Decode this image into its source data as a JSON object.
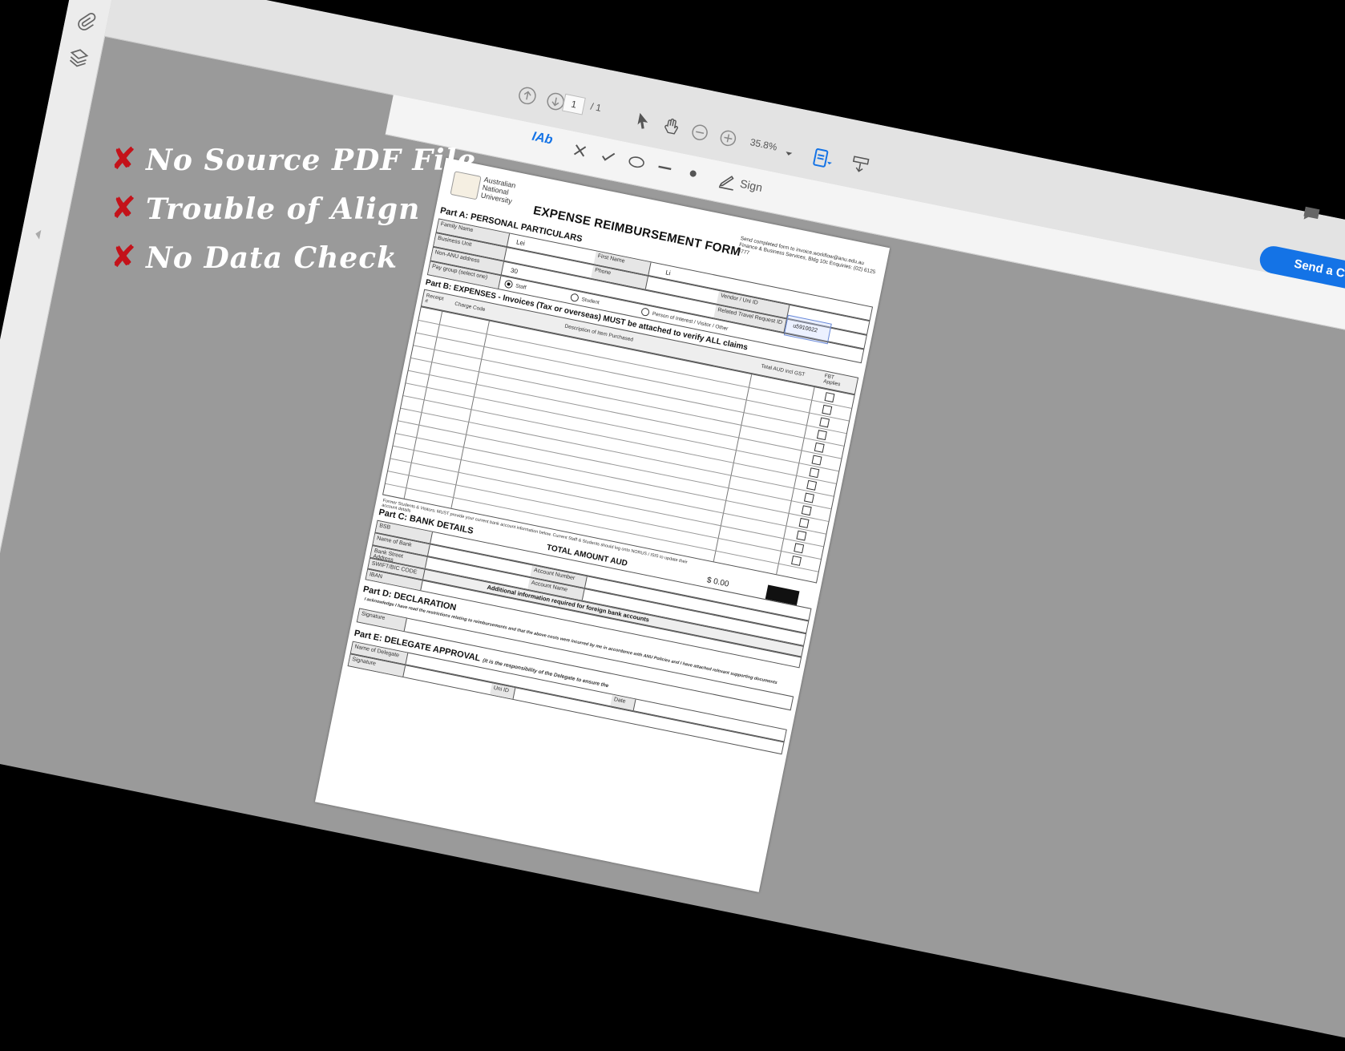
{
  "toolbar": {
    "page_current": "1",
    "page_total": "/ 1",
    "zoom": "35.8%",
    "sign": "Sign",
    "send": "Send a Co"
  },
  "overlay": {
    "items": [
      {
        "mark": "✘",
        "text": "No Source PDF File"
      },
      {
        "mark": "✘",
        "text": "Trouble of Align"
      },
      {
        "mark": "✘",
        "text": "No Data Check"
      }
    ]
  },
  "document": {
    "university": "Australian National University",
    "title": "EXPENSE REIMBURSEMENT FORM",
    "send_note": "Send completed form to invoice.workflow@anu.edu.au Finance & Business Services, Bldg 10c Enquiries: (02) 6125 4777",
    "part_a": "Part A: PERSONAL PARTICULARS",
    "family_name_label": "Family Name",
    "family_name_value": "Lei",
    "first_name_label": "First Name",
    "first_name_value": "Li",
    "business_unit_label": "Business Unit",
    "phone_label": "Phone",
    "vendor_label": "Vendor / Uni ID",
    "non_anu_label": "Non-ANU address",
    "non_anu_value": "30",
    "related_travel_label": "Related Travel Request ID",
    "related_travel_value": "u5910022",
    "pay_group_label": "Pay group (select one)",
    "staff": "Staff",
    "student": "Student",
    "poi": "Person of Interest / Visitor / Other",
    "part_b": "Part B: EXPENSES - Invoices (Tax or overseas) MUST be attached to verify ALL claims",
    "receipt_label": "Receipt #",
    "charge_code_label": "Charge Code",
    "description_label": "Description of Item Purchased",
    "total_incl_label": "Total AUD incl GST",
    "fbt_label": "FBT Applies",
    "former_note": "Former Students & Visitors: MUST provide your current bank account information below. Current Staff & Students should log onto NORUS / ISIS to update their account details",
    "total_amount_label": "TOTAL AMOUNT AUD",
    "total_amount_value": "$ 0.00",
    "part_c": "Part C: BANK DETAILS",
    "bsb_label": "BSB",
    "bank_name_label": "Name of Bank",
    "account_number_label": "Account Number",
    "bank_street_label": "Bank Street Address",
    "account_name_label": "Account Name",
    "swift_label": "SWIFT/BIC CODE",
    "iban_label": "IBAN",
    "foreign_note": "Additional information required for foreign bank accounts",
    "part_d": "Part D: DECLARATION",
    "declaration": "I acknowledge I have read the restrictions relating to reimbursements and that the above costs were incurred by me in accordance with ANU Policies and I have attached relevant supporting documents",
    "signature_label": "Signature",
    "part_e": "Part E: DELEGATE APPROVAL",
    "delegate_note": "(It is the responsibility of the Delegate to ensure the",
    "delegate_name_label": "Name of Delegate",
    "uni_id_label": "Uni ID",
    "date_label": "Date"
  }
}
